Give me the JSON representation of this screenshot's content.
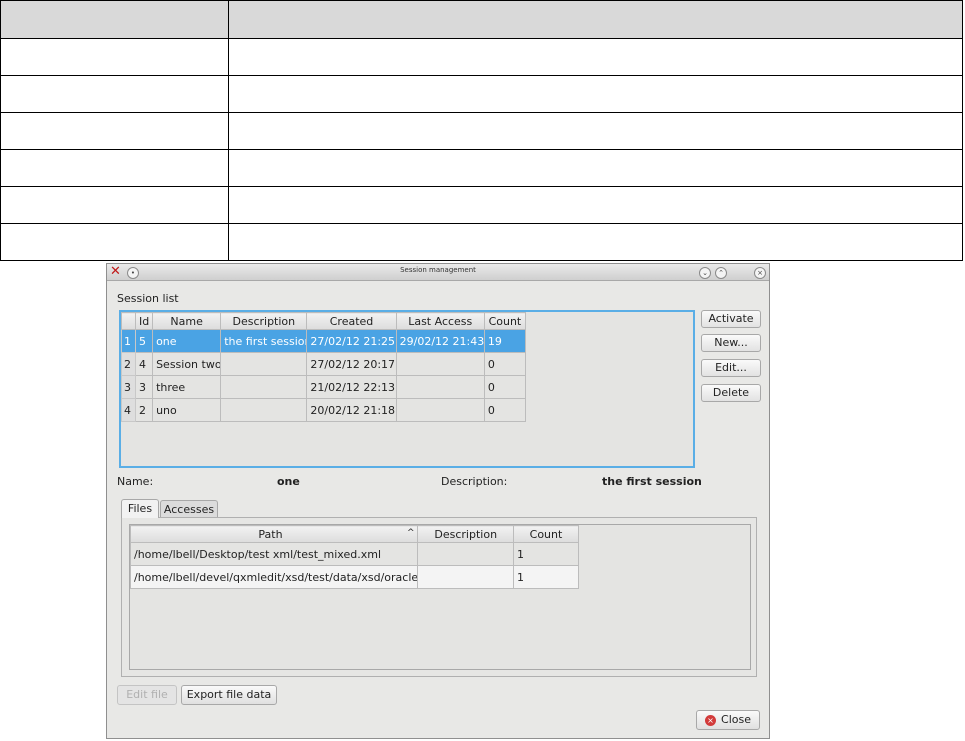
{
  "window": {
    "title": "Session management"
  },
  "session_list": {
    "label": "Session list",
    "columns": [
      "Id",
      "Name",
      "Description",
      "Created",
      "Last Access",
      "Count"
    ],
    "rows": [
      {
        "row": "1",
        "id": "5",
        "name": "one",
        "description": "the first session",
        "created": "27/02/12 21:25",
        "last_access": "29/02/12 21:43",
        "count": "19"
      },
      {
        "row": "2",
        "id": "4",
        "name": "Session two",
        "description": "",
        "created": "27/02/12 20:17",
        "last_access": "",
        "count": "0"
      },
      {
        "row": "3",
        "id": "3",
        "name": "three",
        "description": "",
        "created": "21/02/12 22:13",
        "last_access": "",
        "count": "0"
      },
      {
        "row": "4",
        "id": "2",
        "name": "uno",
        "description": "",
        "created": "20/02/12 21:18",
        "last_access": "",
        "count": "0"
      }
    ]
  },
  "side_buttons": {
    "activate": "Activate",
    "new": "New...",
    "edit": "Edit...",
    "delete": "Delete"
  },
  "details": {
    "name_label": "Name:",
    "name_value": "one",
    "description_label": "Description:",
    "description_value": "the first session"
  },
  "tabs": {
    "files": "Files",
    "accesses": "Accesses"
  },
  "files": {
    "columns": [
      "Path",
      "Description",
      "Count"
    ],
    "rows": [
      {
        "path": "/home/lbell/Desktop/test xml/test_mixed.xml",
        "description": "",
        "count": "1"
      },
      {
        "path": "/home/lbell/devel/qxmledit/xsd/test/data/xsd/oracle.xml",
        "description": "",
        "count": "1"
      }
    ]
  },
  "bottom_buttons": {
    "edit_file": "Edit file",
    "export_file_data": "Export file data",
    "close": "Close"
  }
}
